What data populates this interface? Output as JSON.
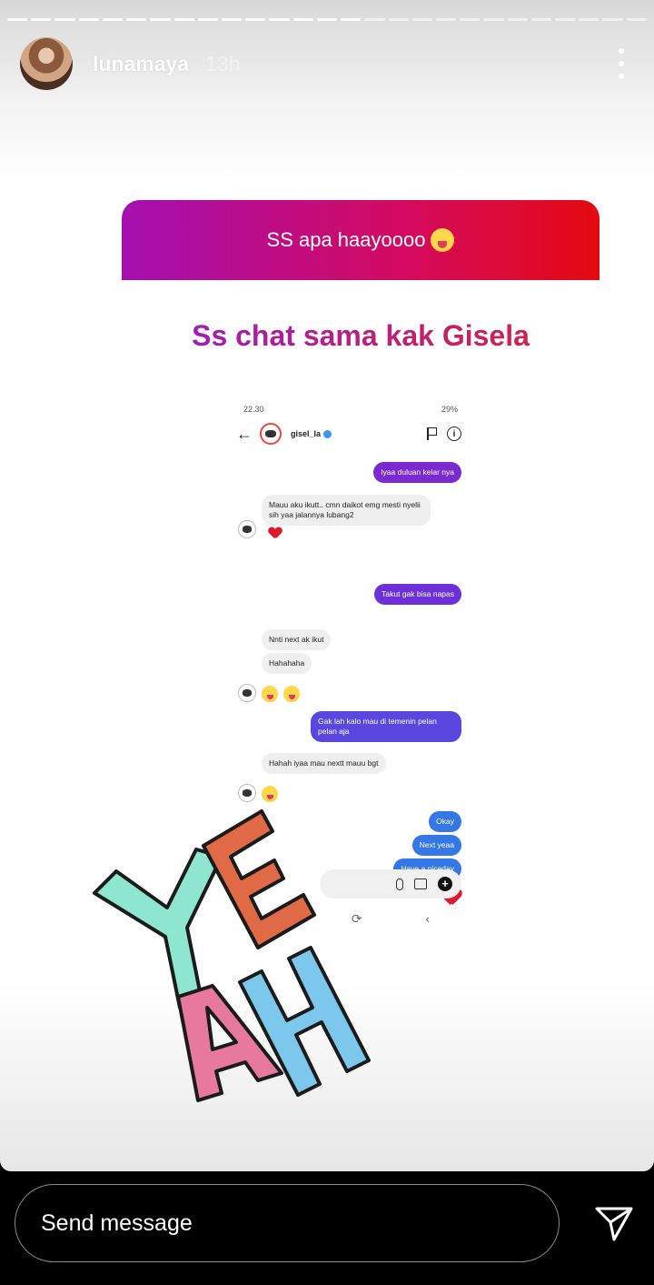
{
  "story": {
    "username": "lunamaya",
    "time_ago": "13h",
    "progress": {
      "segments_total": 27,
      "segments_done": 15
    }
  },
  "question_sticker": {
    "question": "SS apa haayoooo",
    "question_emoji": "zany-face-emoji",
    "answer": "Ss chat sama kak Gisela"
  },
  "screenshot": {
    "status_time": "22.30",
    "status_right": "29%",
    "chat_user": "gisel_la",
    "messages": [
      {
        "side": "out",
        "text": "Iyaa duluan kelar nya",
        "color": "#7a2ad0"
      },
      {
        "side": "in",
        "text": "Mauu aku ikutt.. cmn daikot emg mesti nyelii sih yaa jalannya lubang2",
        "reaction": "heart"
      },
      {
        "side": "out",
        "text": "Takut gak bisa napas",
        "color": "#6d2fd8"
      },
      {
        "side": "in",
        "text": "Nnti next ak ikut"
      },
      {
        "side": "in",
        "text": "Hahahaha"
      },
      {
        "side": "in",
        "emoji": "yum-face-emoji x2"
      },
      {
        "side": "out",
        "text": "Gak lah kalo mau di temenin pelan pelan aja",
        "color": "#5a47e0"
      },
      {
        "side": "in",
        "text": "Hahah iyaa mau nextt mauu bgt"
      },
      {
        "side": "in",
        "emoji": "tongue-face-emoji"
      },
      {
        "side": "out",
        "text": "Okay",
        "color": "#3478e8"
      },
      {
        "side": "out",
        "text": "Next yeaa",
        "color": "#3478e8"
      },
      {
        "side": "out",
        "text": "Have a niceday",
        "color": "#3478e8"
      },
      {
        "side": "out",
        "emoji": "heart-icon"
      }
    ]
  },
  "sticker": {
    "letters": [
      "Y",
      "E",
      "A",
      "H"
    ],
    "colors": {
      "Y": "#8ee6d0",
      "E": "#e06a45",
      "A": "#e8799e",
      "H": "#7cc8ec"
    }
  },
  "footer": {
    "placeholder": "Send message"
  }
}
